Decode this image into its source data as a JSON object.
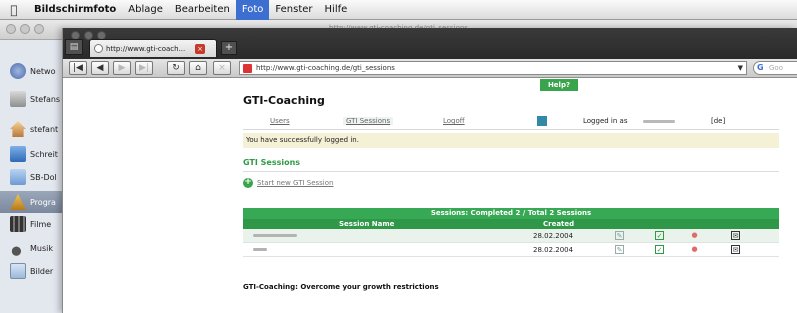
{
  "menubar": {
    "app_name": "Bildschirmfoto",
    "items": [
      "Ablage",
      "Bearbeiten",
      "Foto",
      "Fenster",
      "Hilfe"
    ],
    "active_item": "Foto"
  },
  "background_window": {
    "url": "http://www.gti-coaching.de/gti_sessions"
  },
  "finder_sidebar": {
    "items": [
      "Netwo",
      "Stefans",
      "stefant",
      "Schreit",
      "SB-Dol",
      "Progra",
      "Filme",
      "Musik",
      "Bilder"
    ]
  },
  "browser": {
    "tab_title": "http://www.gti-coach...",
    "url": "http://www.gti-coaching.de/gti_sessions",
    "search_placeholder": "Goo"
  },
  "page": {
    "help_label": "Help?",
    "title": "GTI-Coaching",
    "nav": {
      "users": "Users",
      "gti_sessions": "GTI Sessions",
      "logoff": "Logoff",
      "logged_in_as": "Logged in as",
      "language": "[de]"
    },
    "success_message": "You have successfully logged in.",
    "section_title": "GTI Sessions",
    "start_new_label": "Start new GTI Session",
    "table": {
      "caption": "Sessions: Completed 2 / Total 2 Sessions",
      "col_session_name": "Session Name",
      "col_created": "Created",
      "rows": [
        {
          "created": "28.02.2004"
        },
        {
          "created": "28.02.2004"
        }
      ]
    },
    "tagline": "GTI-Coaching: Overcome your growth restrictions"
  },
  "colors": {
    "accent_green": "#37a853",
    "menu_highlight": "#3d6fd1",
    "message_bg": "#f5f1d6"
  }
}
